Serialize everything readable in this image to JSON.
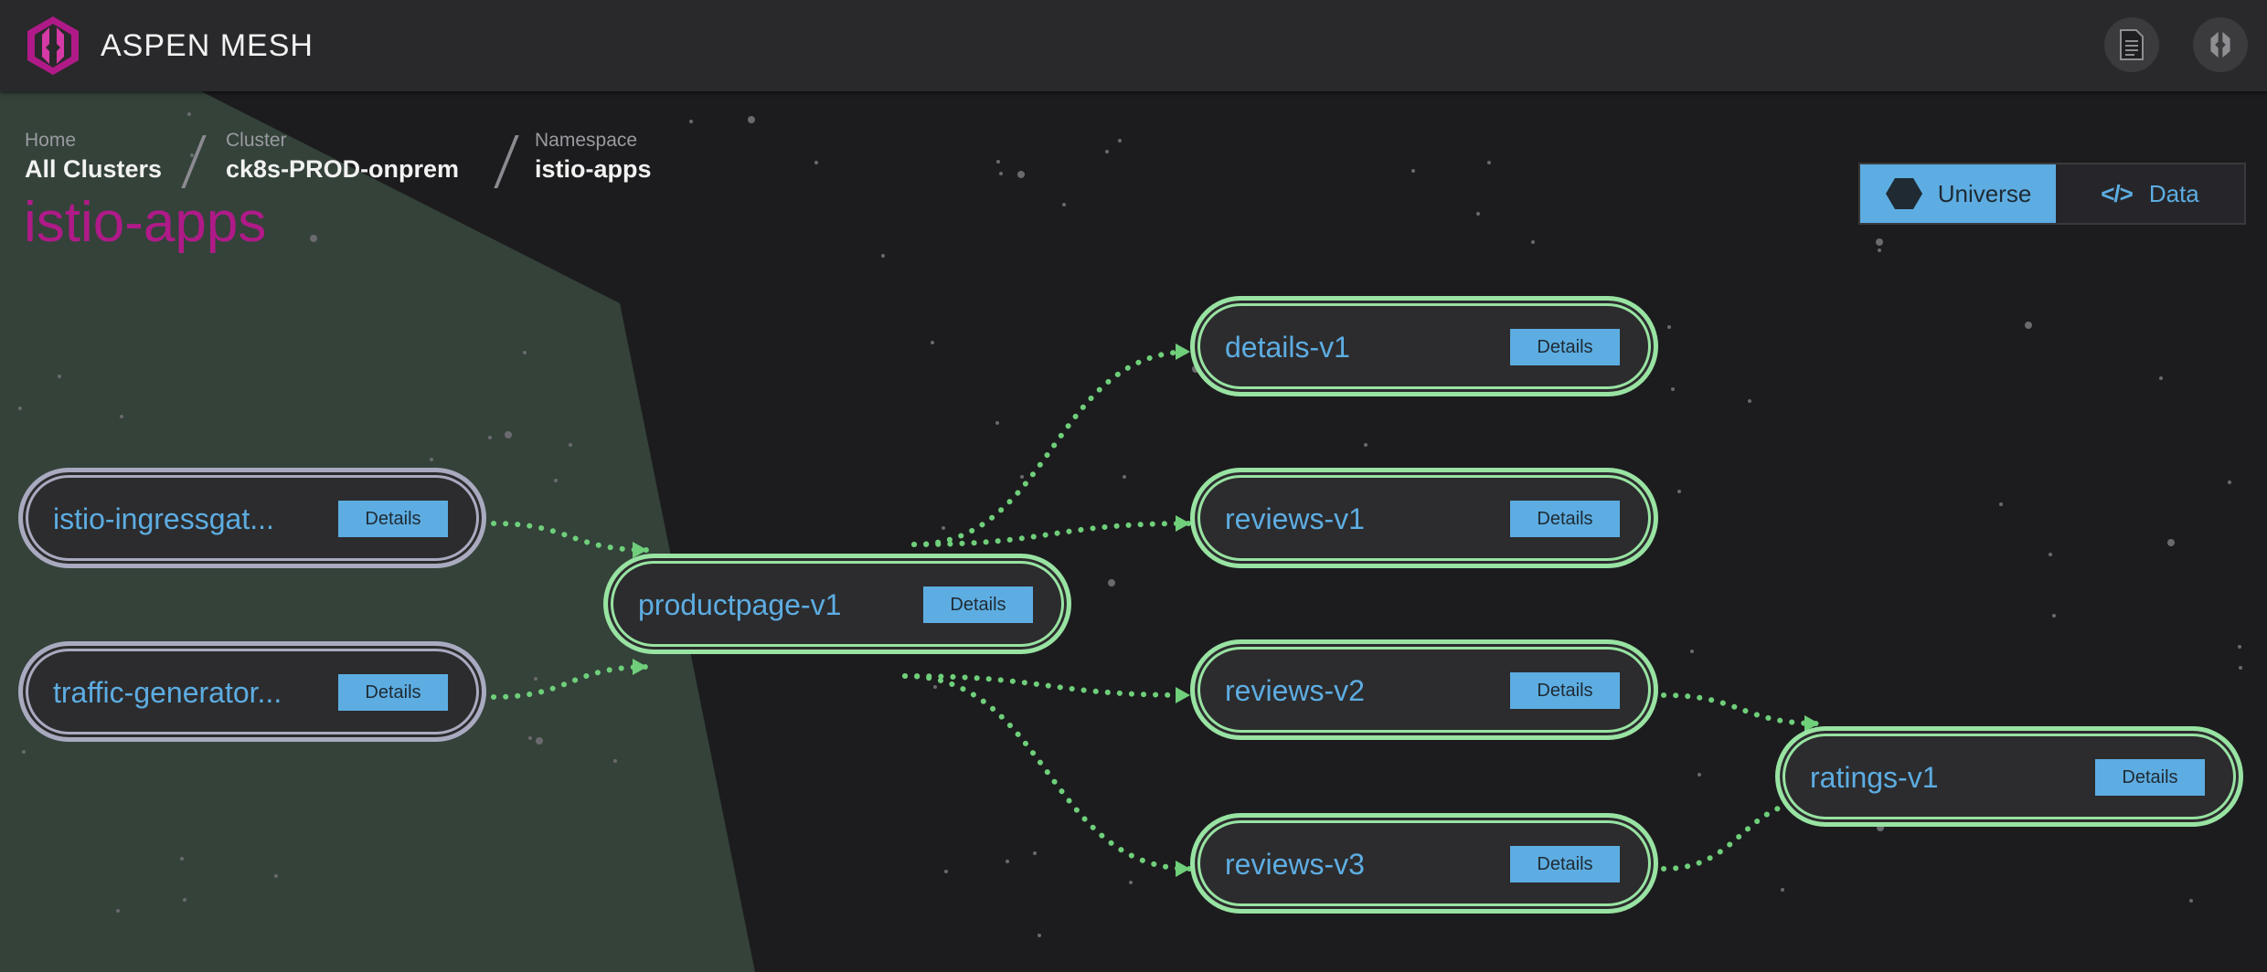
{
  "header": {
    "brand": "ASPEN MESH",
    "icons": [
      "document-icon",
      "aspen-mesh-logo-icon"
    ]
  },
  "breadcrumb": {
    "home": {
      "label": "Home",
      "value": "All Clusters"
    },
    "cluster": {
      "label": "Cluster",
      "value": "ck8s-PROD-onprem"
    },
    "namespace": {
      "label": "Namespace",
      "value": "istio-apps"
    }
  },
  "namespace_title": "istio-apps",
  "view_toggle": {
    "universe": "Universe",
    "data": "Data",
    "selected": "Universe"
  },
  "graph": {
    "details_label": "Details",
    "nodes": [
      {
        "id": "istio-ingressgateway",
        "label": "istio-ingressgat...",
        "status": "external"
      },
      {
        "id": "traffic-generator",
        "label": "traffic-generator...",
        "status": "external"
      },
      {
        "id": "productpage-v1",
        "label": "productpage-v1",
        "status": "healthy"
      },
      {
        "id": "details-v1",
        "label": "details-v1",
        "status": "healthy"
      },
      {
        "id": "reviews-v1",
        "label": "reviews-v1",
        "status": "healthy"
      },
      {
        "id": "reviews-v2",
        "label": "reviews-v2",
        "status": "healthy"
      },
      {
        "id": "reviews-v3",
        "label": "reviews-v3",
        "status": "healthy"
      },
      {
        "id": "ratings-v1",
        "label": "ratings-v1",
        "status": "healthy"
      }
    ],
    "edges": [
      [
        "istio-ingressgateway",
        "productpage-v1"
      ],
      [
        "traffic-generator",
        "productpage-v1"
      ],
      [
        "productpage-v1",
        "details-v1"
      ],
      [
        "productpage-v1",
        "reviews-v1"
      ],
      [
        "productpage-v1",
        "reviews-v2"
      ],
      [
        "productpage-v1",
        "reviews-v3"
      ],
      [
        "reviews-v2",
        "ratings-v1"
      ],
      [
        "reviews-v3",
        "ratings-v1"
      ]
    ]
  },
  "colors": {
    "brand": "#b01a88",
    "accent": "#5dade2",
    "healthy": "#98e3a2",
    "external": "#a9aac0",
    "edge": "#6fcf7a",
    "cluster_region": "#34423a"
  }
}
